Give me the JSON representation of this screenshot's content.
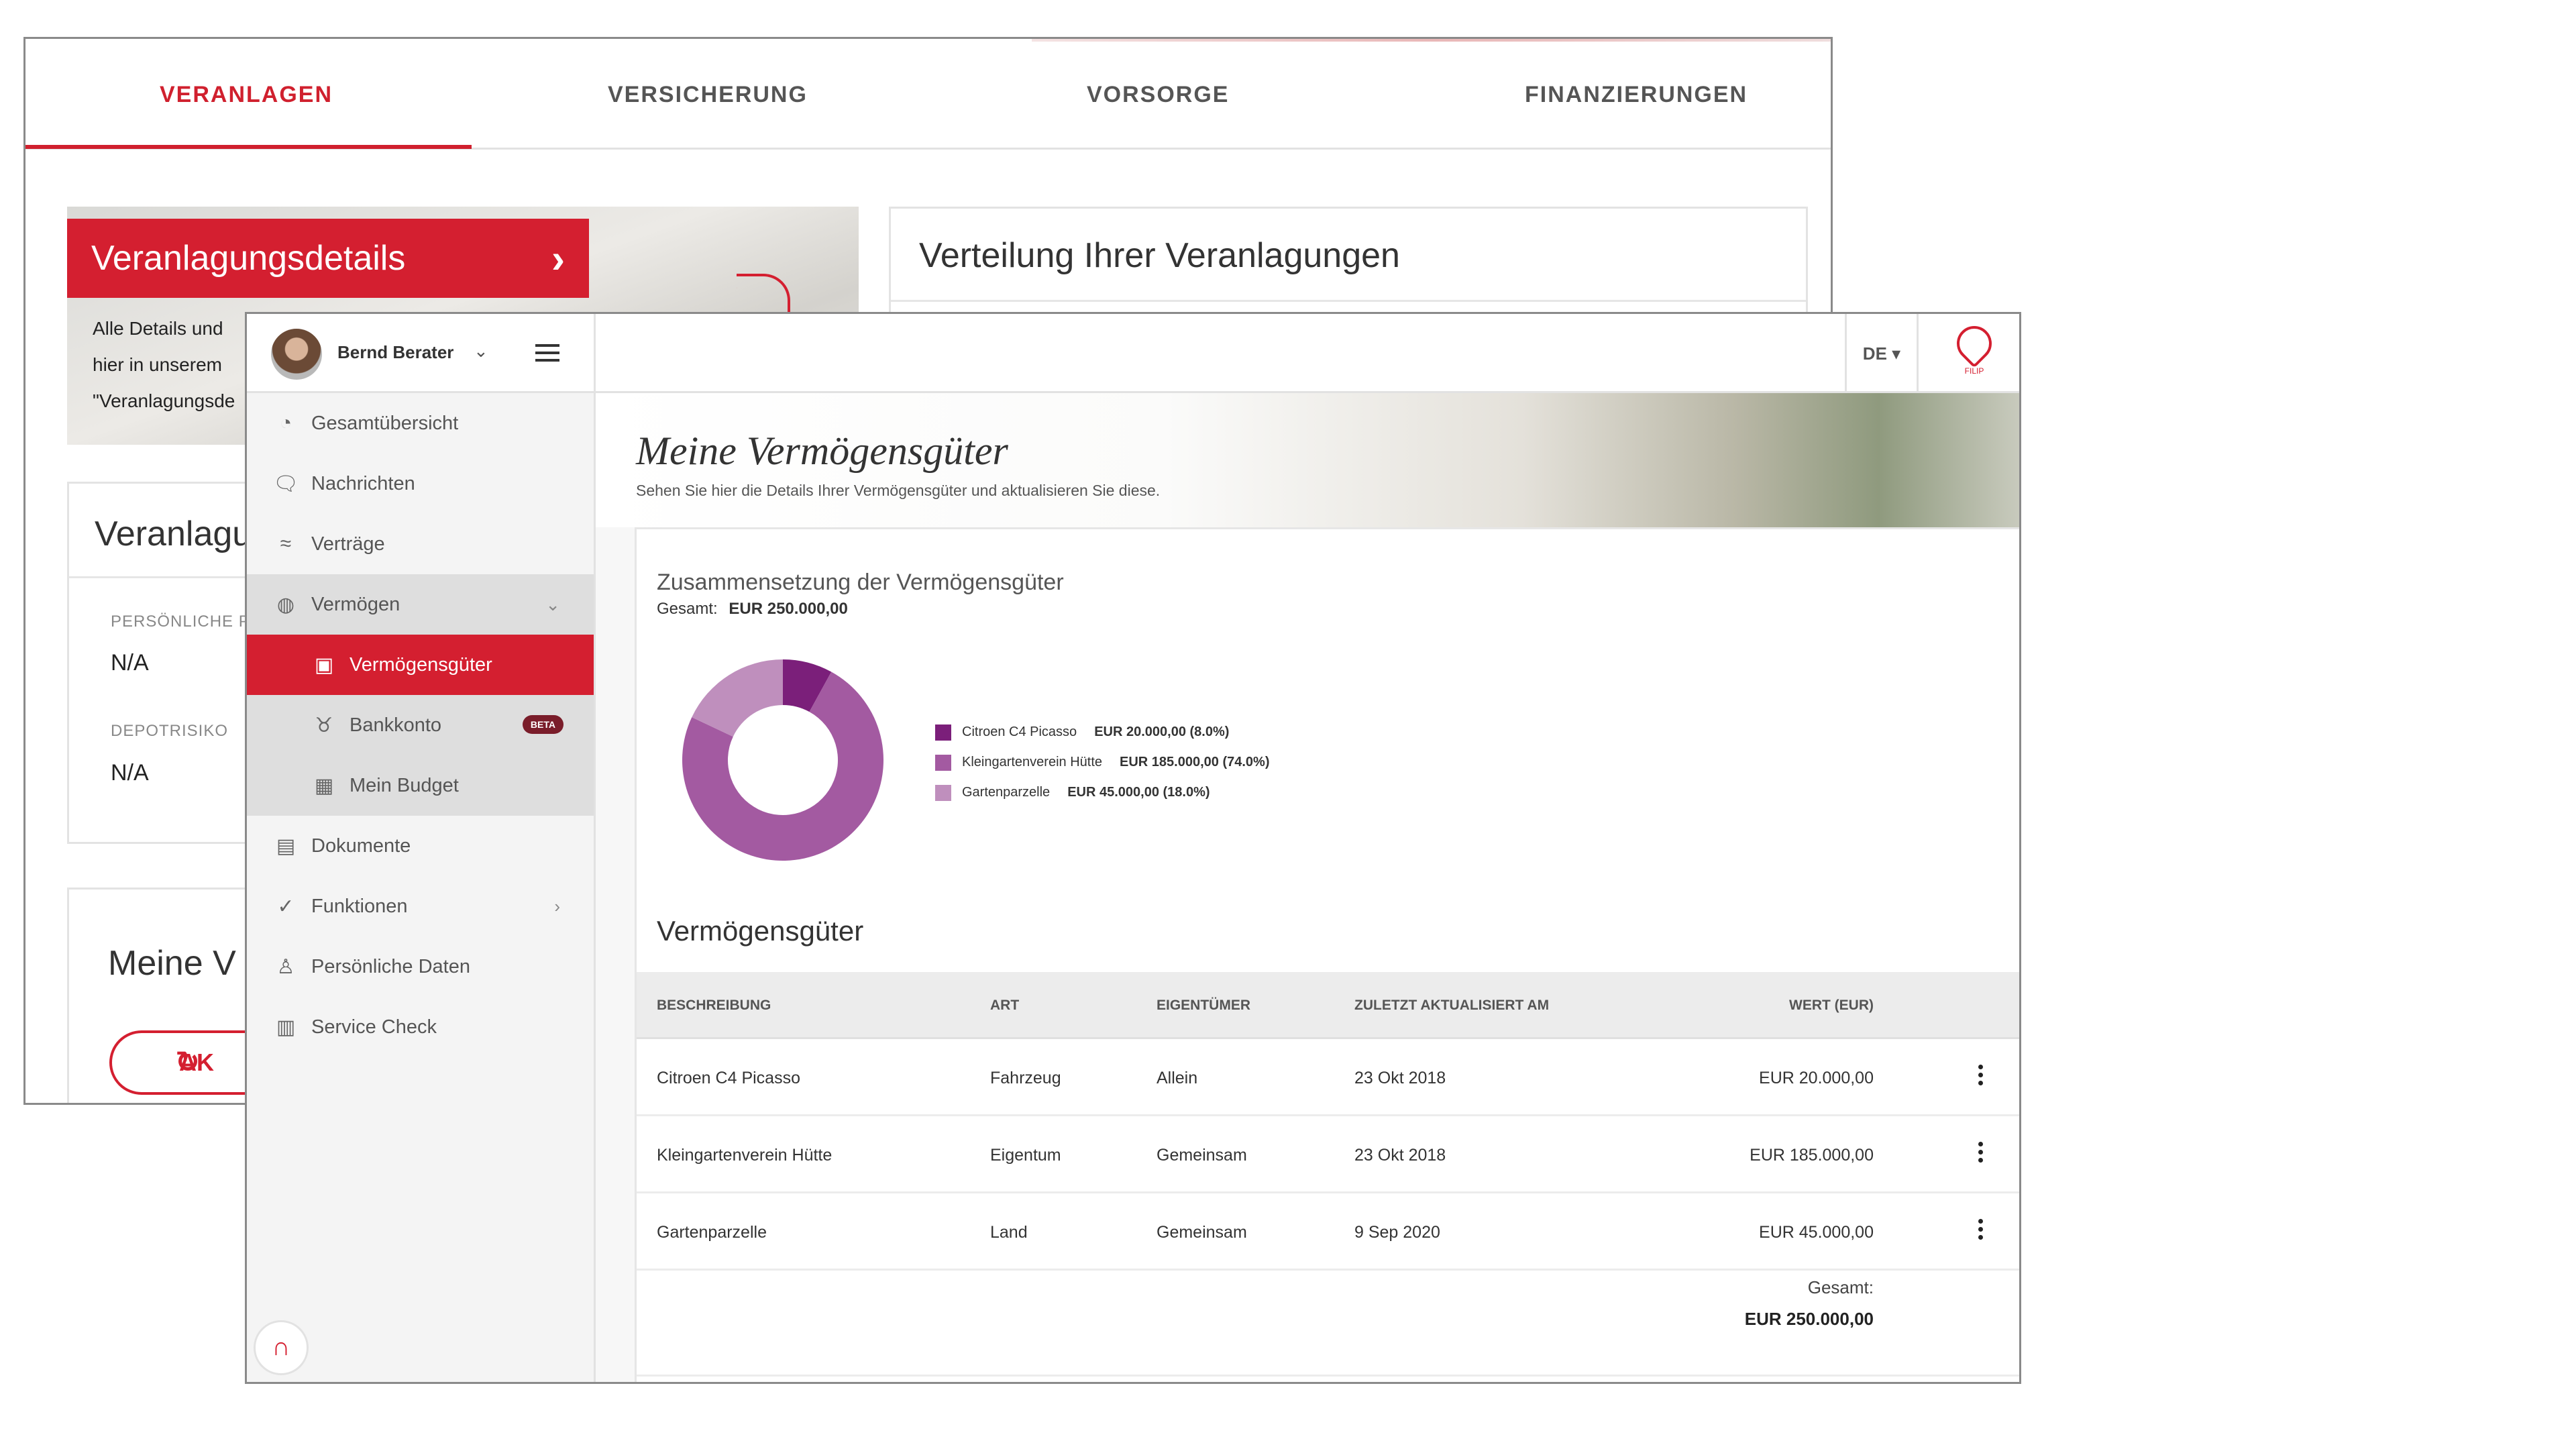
{
  "back": {
    "tabs": [
      {
        "label": "VERANLAGEN"
      },
      {
        "label": "VERSICHERUNG"
      },
      {
        "label": "VORSORGE"
      },
      {
        "label": "FINANZIERUNGEN"
      }
    ],
    "banner_title": "Veranlagungsdetails",
    "banner_desc": [
      "Alle Details und",
      "hier in unserem",
      "\"Veranlagungsde"
    ],
    "vert_title": "Verteilung Ihrer Veranlagungen",
    "card_title": "Veranlagu",
    "personal_label": "PERSÖNLICHE PE",
    "personal_value": "N/A",
    "depot_label": "DEPOTRISIKO",
    "depot_value": "N/A",
    "card2_title": "Meine V",
    "pill_label": "AK"
  },
  "topbar": {
    "user_name": "Bernd Berater",
    "language": "DE",
    "filip_label": "FILIP"
  },
  "sidebar": {
    "items": [
      {
        "label": "Gesamtübersicht",
        "icon": "gauge-icon"
      },
      {
        "label": "Nachrichten",
        "icon": "chat-icon"
      },
      {
        "label": "Verträge",
        "icon": "handshake-icon"
      },
      {
        "label": "Vermögen",
        "icon": "globe-icon"
      },
      {
        "label": "Vermögensgüter",
        "icon": "wallet-icon"
      },
      {
        "label": "Bankkonto",
        "icon": "piggy-bank-icon",
        "badge": "BETA"
      },
      {
        "label": "Mein Budget",
        "icon": "calculator-icon"
      },
      {
        "label": "Dokumente",
        "icon": "document-icon"
      },
      {
        "label": "Funktionen",
        "icon": "check-circle-icon"
      },
      {
        "label": "Persönliche Daten",
        "icon": "person-icon"
      },
      {
        "label": "Service Check",
        "icon": "clipboard-icon"
      }
    ]
  },
  "main": {
    "title": "Meine Vermögensgüter",
    "subtitle": "Sehen Sie hier die Details Ihrer Vermögensgüter und aktualisieren Sie diese.",
    "composition_title": "Zusammensetzung der Vermögensgüter",
    "total_label": "Gesamt:",
    "total_value": "EUR 250.000,00",
    "assets_title": "Vermögensgüter",
    "columns": [
      "BESCHREIBUNG",
      "ART",
      "EIGENTÜMER",
      "ZULETZT AKTUALISIERT AM",
      "WERT (EUR)"
    ],
    "rows": [
      {
        "desc": "Citroen C4 Picasso",
        "type": "Fahrzeug",
        "owner": "Allein",
        "updated": "23 Okt 2018",
        "value": "EUR 20.000,00"
      },
      {
        "desc": "Kleingartenverein Hütte",
        "type": "Eigentum",
        "owner": "Gemeinsam",
        "updated": "23 Okt 2018",
        "value": "EUR 185.000,00"
      },
      {
        "desc": "Gartenparzelle",
        "type": "Land",
        "owner": "Gemeinsam",
        "updated": "9 Sep 2020",
        "value": "EUR 45.000,00"
      }
    ],
    "table_total_label": "Gesamt:",
    "table_total_value": "EUR 250.000,00"
  },
  "chart_data": {
    "type": "pie",
    "categories": [
      "Citroen C4 Picasso",
      "Kleingartenverein Hütte",
      "Gartenparzelle"
    ],
    "values": [
      20000,
      185000,
      45000
    ],
    "value_labels": [
      "EUR 20.000,00 (8.0%)",
      "EUR 185.000,00 (74.0%)",
      "EUR 45.000,00 (18.0%)"
    ],
    "colors": [
      "#7b1f7a",
      "#a35aa1",
      "#bf8fbd"
    ],
    "title": "Zusammensetzung der Vermögensgüter",
    "legend": "right"
  }
}
